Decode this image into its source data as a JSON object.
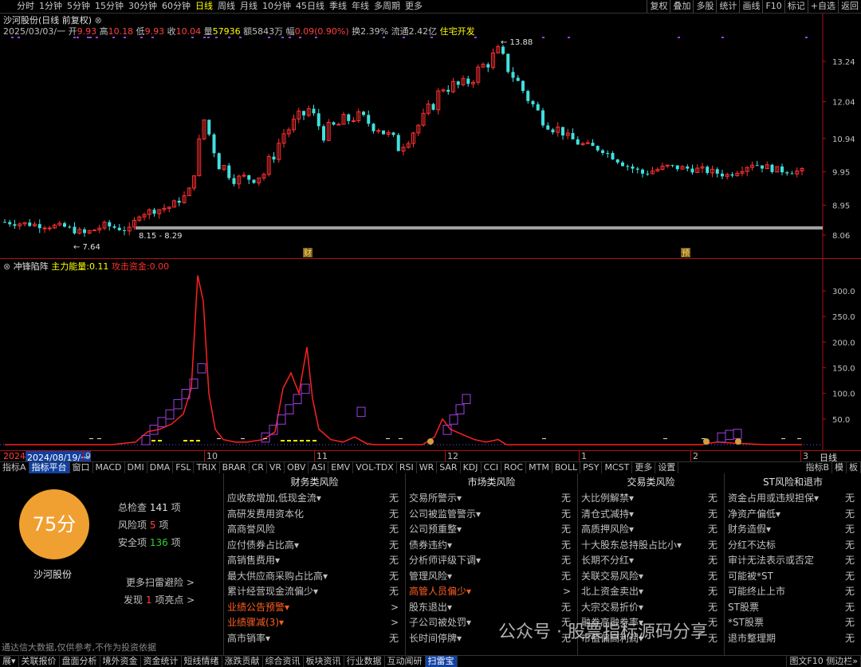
{
  "topbar": {
    "timeframes": [
      "分时",
      "1分钟",
      "5分钟",
      "15分钟",
      "30分钟",
      "60分钟",
      "日线",
      "周线",
      "月线",
      "10分钟",
      "45日线",
      "季线",
      "年线",
      "多周期",
      "更多"
    ],
    "active": "日线",
    "right_buttons": [
      "复权",
      "叠加",
      "多股",
      "统计",
      "画线",
      "F10",
      "标记",
      "+自选",
      "返回"
    ]
  },
  "stock": {
    "title": "沙河股份(日线 前复权)",
    "date": "2025/03/03/一",
    "open_label": "开",
    "open": "9.93",
    "high_label": "高",
    "high": "10.18",
    "low_label": "低",
    "low": "9.93",
    "close_label": "收",
    "close": "10.04",
    "vol_label": "量",
    "vol": "57936",
    "amount_label": "额",
    "amount": "5843万",
    "change_label": "幅",
    "change": "0.09(0.90%)",
    "turnover_label": "换",
    "turnover": "2.39%",
    "float_label": "流通",
    "float": "2.42亿",
    "sector": "住宅开发"
  },
  "main_axis": [
    "13.24",
    "12.04",
    "10.94",
    "9.95",
    "8.95",
    "8.06"
  ],
  "annotations": {
    "max": "13.88",
    "min": "7.64",
    "range": "8.15 - 8.29",
    "tag1": "财",
    "tag2": "预"
  },
  "indicator": {
    "name": "冲锋陷阵",
    "l1_label": "主力能量:",
    "l1_val": "0.11",
    "l2_label": "攻击资金:",
    "l2_val": "0.00",
    "axis": [
      "300.0",
      "250.0",
      "200.0",
      "150.0",
      "100.0",
      "50.0"
    ]
  },
  "xaxis": {
    "left": "2024",
    "date": "2024/08/19/一",
    "ticks": [
      "9",
      "10",
      "11",
      "12",
      "1",
      "2",
      "3"
    ],
    "right": "日线"
  },
  "tabs": [
    "指标A",
    "指标平台",
    "窗口",
    "MACD",
    "DMI",
    "DMA",
    "FSL",
    "TRIX",
    "BRAR",
    "CR",
    "VR",
    "OBV",
    "ASI",
    "EMV",
    "VOL-TDX",
    "RSI",
    "WR",
    "SAR",
    "KDJ",
    "CCI",
    "ROC",
    "MTM",
    "BOLL",
    "PSY",
    "MCST",
    "更多",
    "设置"
  ],
  "tabs_right": [
    "指标B",
    "模",
    "板"
  ],
  "panel": {
    "score": "75分",
    "name": "沙河股份",
    "total_label": "总检查",
    "total": "141",
    "total_unit": "项",
    "risk_label": "风险项",
    "risk": "5",
    "risk_unit": "项",
    "safe_label": "安全项",
    "safe": "136",
    "safe_unit": "项",
    "more": "更多扫雷避险 >",
    "find_label": "发现",
    "find": "1",
    "find_unit": "项亮点 >",
    "disclaimer": "通达信大数据,仅供参考,不作为投资依据",
    "columns": [
      {
        "title": "财务类风险",
        "rows": [
          {
            "label": "应收款增加,低现金流▾",
            "val": "无"
          },
          {
            "label": "高研发费用资本化",
            "val": "无"
          },
          {
            "label": "高商誉风险",
            "val": "无"
          },
          {
            "label": "应付债券占比高▾",
            "val": "无"
          },
          {
            "label": "高销售费用▾",
            "val": "无"
          },
          {
            "label": "最大供应商采购占比高▾",
            "val": "无"
          },
          {
            "label": "累计经营现金流偏少▾",
            "val": "无"
          },
          {
            "label": "业绩公告预警▾",
            "val": ">",
            "hl": "orange"
          },
          {
            "label": "业绩骤减(3)▾",
            "val": ">",
            "hl": "orange"
          },
          {
            "label": "高市销率▾",
            "val": "无"
          }
        ]
      },
      {
        "title": "市场类风险",
        "rows": [
          {
            "label": "交易所警示▾",
            "val": "无"
          },
          {
            "label": "公司被监管警示▾",
            "val": "无"
          },
          {
            "label": "公司预重整▾",
            "val": "无"
          },
          {
            "label": "债券违约▾",
            "val": "无"
          },
          {
            "label": "分析师评级下调▾",
            "val": "无"
          },
          {
            "label": "管理风险▾",
            "val": "无"
          },
          {
            "label": "高管人员偏少▾",
            "val": ">",
            "hl": "orange"
          },
          {
            "label": "股东退出▾",
            "val": "无"
          },
          {
            "label": "子公司被处罚▾",
            "val": "无"
          },
          {
            "label": "长时间停牌▾",
            "val": "无"
          }
        ]
      },
      {
        "title": "交易类风险",
        "rows": [
          {
            "label": "大比例解禁▾",
            "val": "无"
          },
          {
            "label": "清仓式减持▾",
            "val": "无"
          },
          {
            "label": "高质押风险▾",
            "val": "无"
          },
          {
            "label": "十大股东总持股占比小▾",
            "val": "无"
          },
          {
            "label": "长期不分红▾",
            "val": "无"
          },
          {
            "label": "关联交易风险▾",
            "val": "无"
          },
          {
            "label": "北上资金卖出▾",
            "val": "无"
          },
          {
            "label": "大宗交易折价▾",
            "val": "无"
          },
          {
            "label": "融券高融券率▾",
            "val": "无"
          },
          {
            "label": "市值偏高利润▾",
            "val": "无"
          }
        ]
      },
      {
        "title": "ST风险和退市",
        "rows": [
          {
            "label": "资金占用或违规担保▾",
            "val": "无"
          },
          {
            "label": "净资产偏低▾",
            "val": "无"
          },
          {
            "label": "财务造假▾",
            "val": "无"
          },
          {
            "label": "分红不达标",
            "val": "无"
          },
          {
            "label": "审计无法表示或否定",
            "val": "无"
          },
          {
            "label": "可能被*ST",
            "val": "无"
          },
          {
            "label": "可能终止上市",
            "val": "无"
          },
          {
            "label": "ST股票",
            "val": "无"
          },
          {
            "label": "*ST股票",
            "val": "无"
          },
          {
            "label": "退市整理期",
            "val": "无"
          }
        ]
      }
    ]
  },
  "statusbar": [
    "展▾",
    "关联报价",
    "盘面分析",
    "境外资金",
    "资金统计",
    "短线情绪",
    "涨跌贡献",
    "综合资讯",
    "板块资讯",
    "行业数据",
    "互动闻研",
    "扫雷宝"
  ],
  "statusbar_right": "图文F10 侧边栏»",
  "watermark": "公众号 · 股票指标源码分享",
  "colors": {
    "up": "#ff3030",
    "down": "#40e0e0",
    "purple": "#a040e0",
    "yellow": "#ffff00"
  }
}
